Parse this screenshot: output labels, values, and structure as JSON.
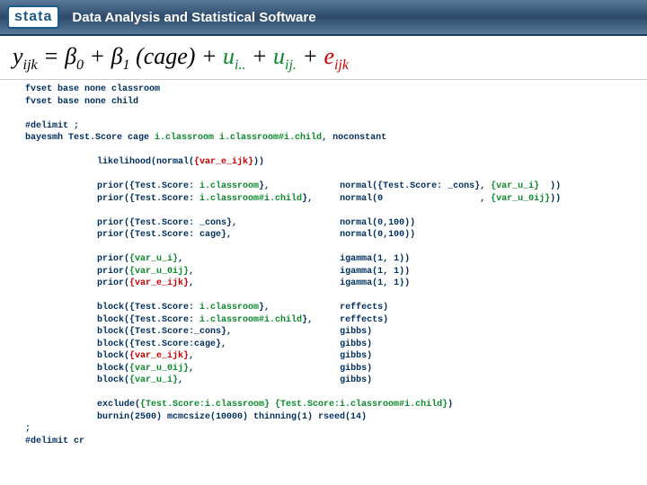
{
  "header": {
    "logo": "stata",
    "title": "Data Analysis and Statistical Software"
  },
  "equation": {
    "y": "y",
    "y_sub": "ijk",
    "eq": " = ",
    "b0": "β",
    "b0_sub": "0",
    "plus1": " + ",
    "b1": "β",
    "b1_sub": "1",
    "cage": "(cage)",
    "plus2": " + ",
    "u1": "u",
    "u1_sub": "i..",
    "plus3": " + ",
    "u2": "u",
    "u2_sub": "ij.",
    "plus4": " + ",
    "e": "e",
    "e_sub": "ijk"
  },
  "code": {
    "l1": "fvset base none classroom",
    "l2": "fvset base none child",
    "l3": "",
    "l4": "#delimit ;",
    "l5a": "bayesmh Test.Score cage ",
    "l5b": "i.classroom i.classroom#i.child",
    "l5c": ", noconstant",
    "l6": "",
    "lik_a": "likelihood(normal(",
    "lik_b": "{var_e_ijk}",
    "lik_c": "))",
    "p1a": "prior({Test.Score: ",
    "p1b": "i.classroom",
    "p1c": "},",
    "p1d": "normal({Test.Score: _cons}, ",
    "p1e": "{var_u_i}",
    "p1f": "  ))",
    "p2a": "prior({Test.Score: ",
    "p2b": "i.classroom#i.child",
    "p2c": "},",
    "p2d": "normal(0                  , ",
    "p2e": "{var_u_0ij}",
    "p2f": "))",
    "p3a": "prior({Test.Score: _cons},",
    "p3b": "normal(0,100))",
    "p4a": "prior({Test.Score: cage},",
    "p4b": "normal(0,100))",
    "p5a": "prior(",
    "p5b": "{var_u_i}",
    "p5c": ",",
    "p5d": "igamma(1, 1))",
    "p6a": "prior(",
    "p6b": "{var_u_0ij}",
    "p6c": ",",
    "p6d": "igamma(1, 1))",
    "p7a": "prior(",
    "p7b": "{var_e_ijk}",
    "p7c": ",",
    "p7d": "igamma(1, 1))",
    "b1a": "block({Test.Score: ",
    "b1b": "i.classroom",
    "b1c": "},",
    "b1d": "reffects)",
    "b2a": "block({Test.Score: ",
    "b2b": "i.classroom#i.child",
    "b2c": "},",
    "b2d": "reffects)",
    "b3a": "block({Test.Score:_cons},",
    "b3b": "gibbs)",
    "b4a": "block({Test.Score:cage},",
    "b4b": "gibbs)",
    "b5a": "block(",
    "b5b": "{var_e_ijk}",
    "b5c": ",",
    "b5d": "gibbs)",
    "b6a": "block(",
    "b6b": "{var_u_0ij}",
    "b6c": ",",
    "b6d": "gibbs)",
    "b7a": "block(",
    "b7b": "{var_u_i}",
    "b7c": ",",
    "b7d": "gibbs)",
    "ex_a": "exclude(",
    "ex_b": "{Test.Score:i.classroom} {Test.Score:i.classroom#i.child}",
    "ex_c": ")",
    "burn": "burnin(2500) mcmcsize(10000) thinning(1) rseed(14)",
    "semi": ";",
    "delcr": "#delimit cr"
  }
}
